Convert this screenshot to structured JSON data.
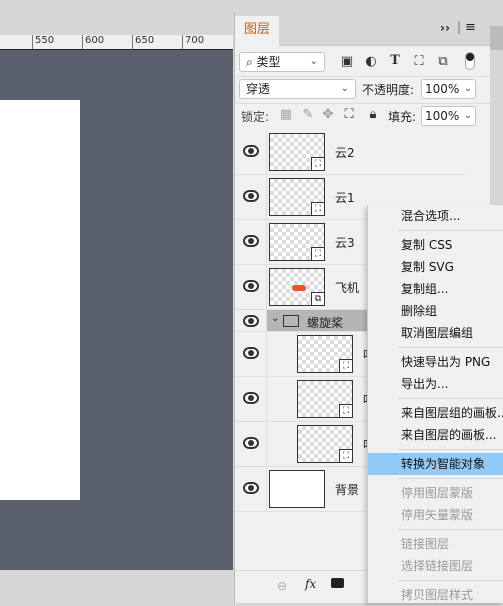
{
  "ruler": {
    "ticks": [
      "550",
      "600",
      "650",
      "700"
    ]
  },
  "panel": {
    "tab": "图层",
    "filter": {
      "value": "类型",
      "icons": [
        "image-filter-icon",
        "adjustment-filter-icon",
        "type-filter-icon",
        "shape-filter-icon",
        "smart-object-filter-icon"
      ]
    },
    "blend_mode": "穿透",
    "opacity_label": "不透明度:",
    "opacity": "100%",
    "lock_label": "锁定:",
    "fill_label": "填充:",
    "fill": "100%",
    "layers": [
      {
        "name": "云2",
        "type": "smart"
      },
      {
        "name": "云1",
        "type": "smart"
      },
      {
        "name": "云3",
        "type": "smart"
      },
      {
        "name": "飞机",
        "type": "smart-linked"
      },
      {
        "name": "螺旋桨",
        "type": "group"
      },
      {
        "name": "叶",
        "type": "smart",
        "child": true
      },
      {
        "name": "叶",
        "type": "smart",
        "child": true
      },
      {
        "name": "叶",
        "type": "smart",
        "child": true
      },
      {
        "name": "背景",
        "type": "background"
      }
    ]
  },
  "menu": {
    "items": [
      {
        "label": "混合选项...",
        "state": "normal"
      },
      {
        "sep": true
      },
      {
        "label": "复制 CSS",
        "state": "normal"
      },
      {
        "label": "复制 SVG",
        "state": "normal"
      },
      {
        "label": "复制组...",
        "state": "normal"
      },
      {
        "label": "删除组",
        "state": "normal"
      },
      {
        "label": "取消图层编组",
        "state": "normal"
      },
      {
        "sep": true
      },
      {
        "label": "快速导出为 PNG",
        "state": "normal"
      },
      {
        "label": "导出为...",
        "state": "normal"
      },
      {
        "sep": true
      },
      {
        "label": "来自图层组的画板...",
        "state": "normal"
      },
      {
        "label": "来自图层的画板...",
        "state": "normal"
      },
      {
        "sep": true
      },
      {
        "label": "转换为智能对象",
        "state": "highlighted"
      },
      {
        "sep": true
      },
      {
        "label": "停用图层蒙版",
        "state": "disabled"
      },
      {
        "label": "停用矢量蒙版",
        "state": "disabled"
      },
      {
        "sep": true
      },
      {
        "label": "链接图层",
        "state": "disabled"
      },
      {
        "label": "选择链接图层",
        "state": "disabled"
      },
      {
        "sep": true
      },
      {
        "label": "拷贝图层样式",
        "state": "disabled"
      }
    ]
  },
  "colors": {
    "canvas": "#5a606b",
    "highlight": "#91c9f7",
    "tab_text": "#c0651e",
    "group_row": "#b5b5b5"
  }
}
